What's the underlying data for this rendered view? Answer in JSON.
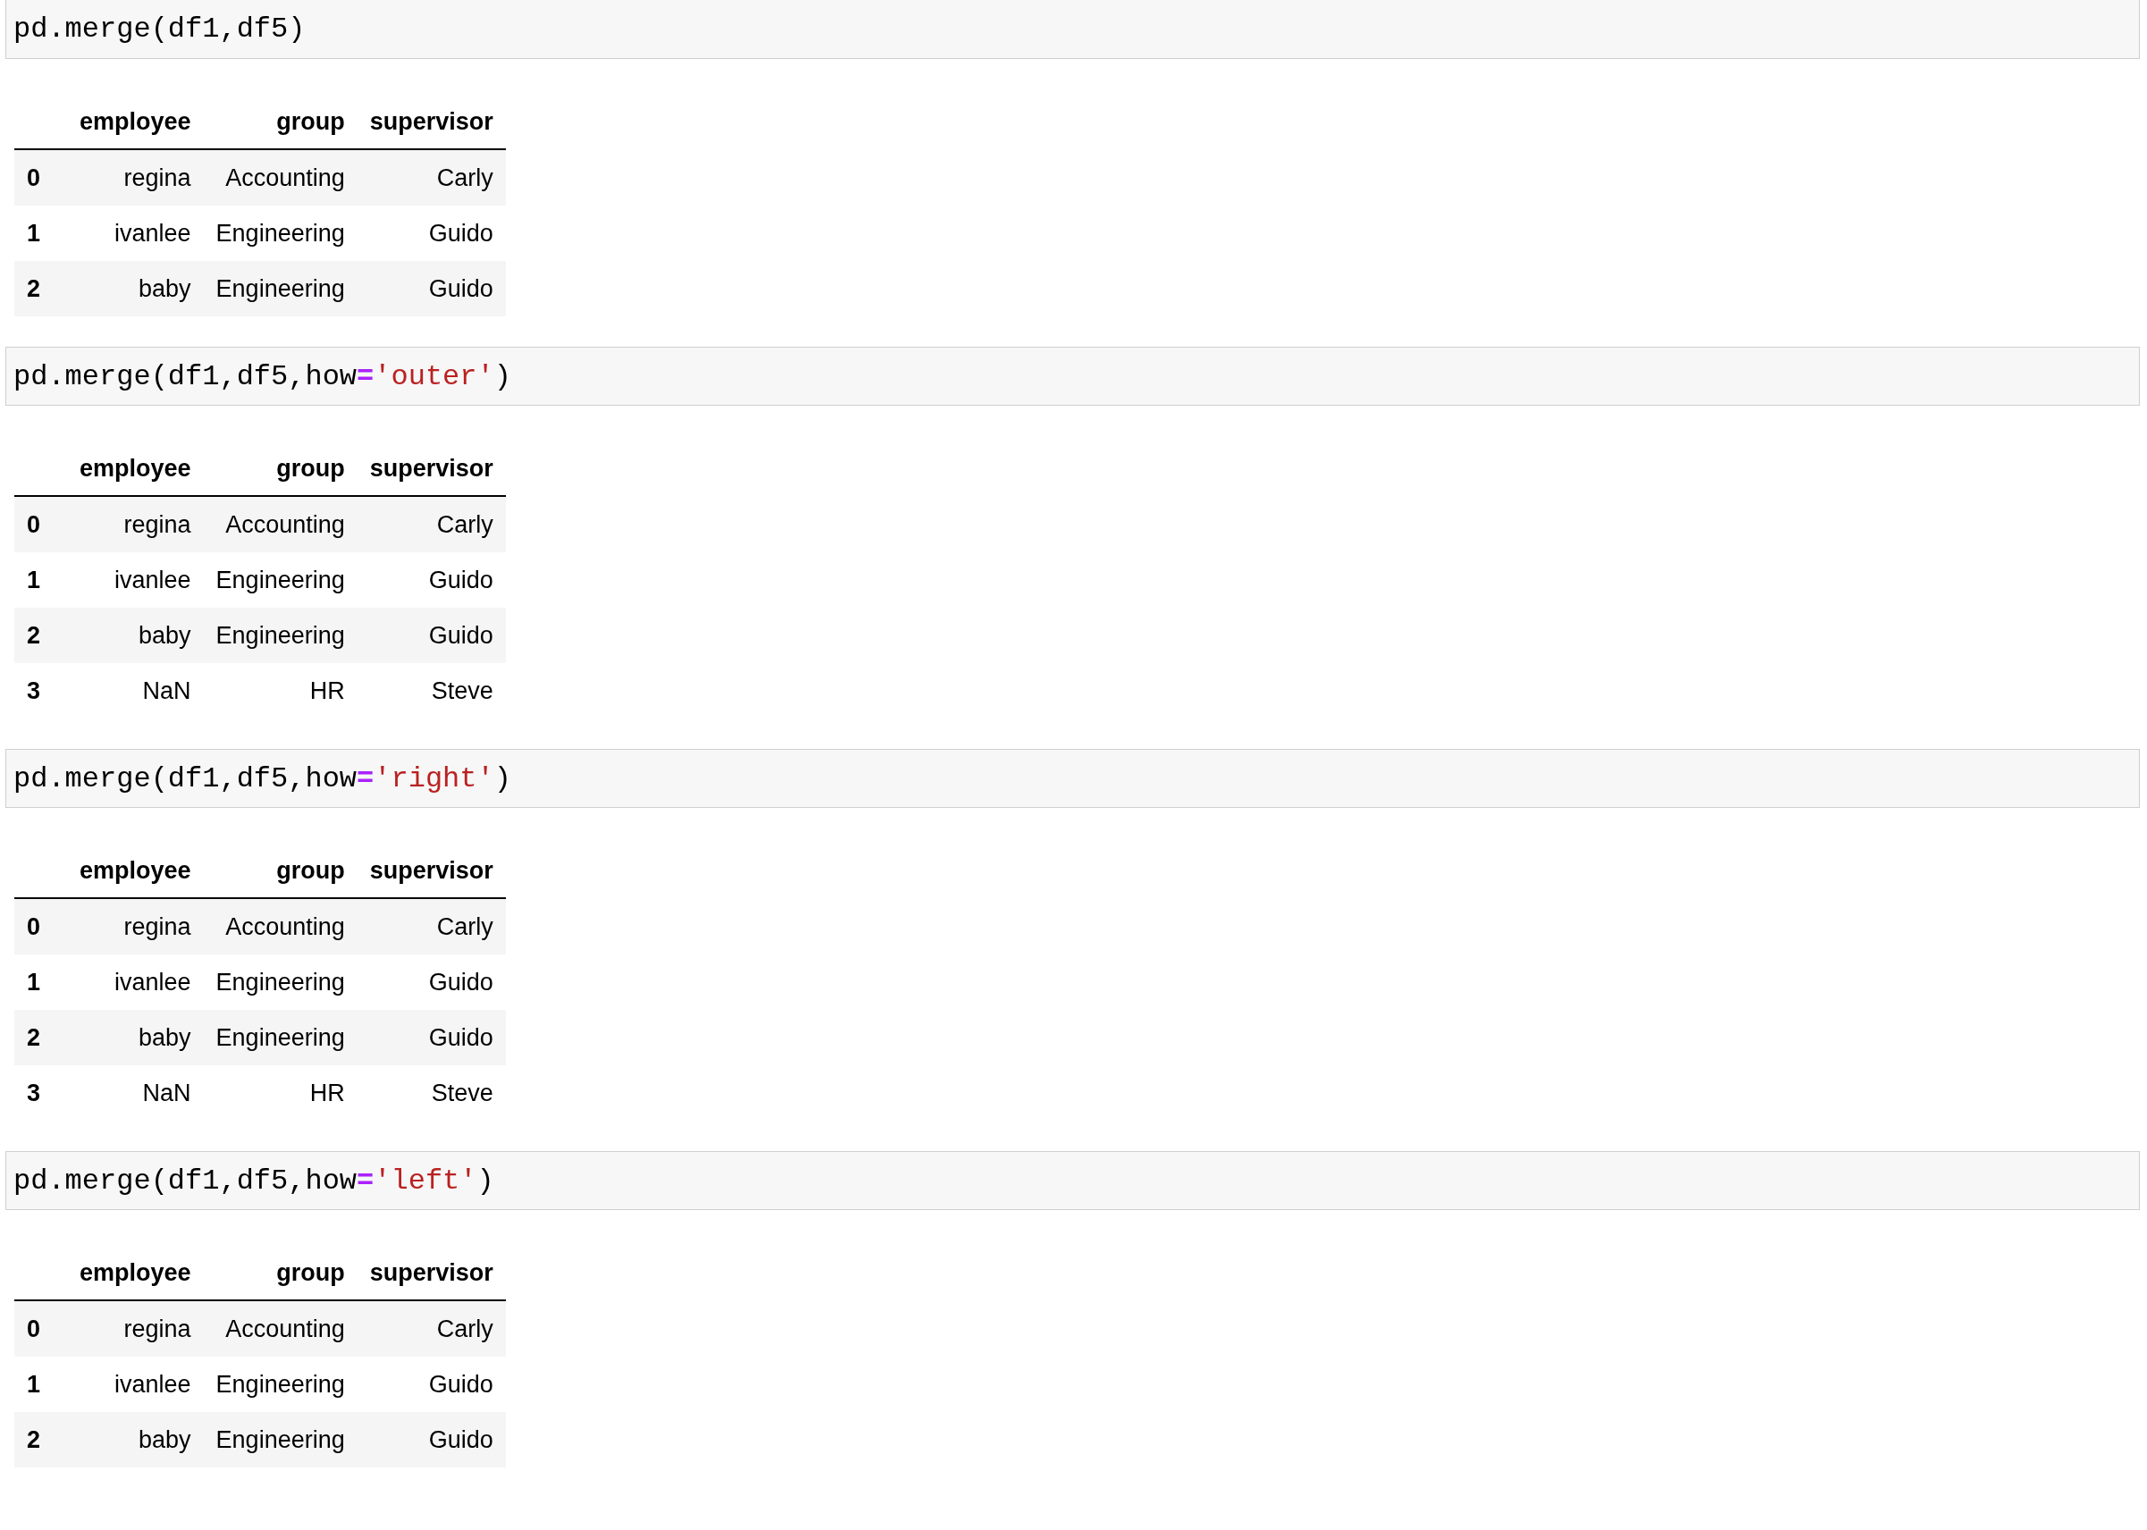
{
  "cells": [
    {
      "code": [
        {
          "kind": "plain",
          "text": "pd.merge(df1,df5)"
        }
      ],
      "table": {
        "columns": [
          "employee",
          "group",
          "supervisor"
        ],
        "rows": [
          {
            "index": "0",
            "values": [
              "regina",
              "Accounting",
              "Carly"
            ]
          },
          {
            "index": "1",
            "values": [
              "ivanlee",
              "Engineering",
              "Guido"
            ]
          },
          {
            "index": "2",
            "values": [
              "baby",
              "Engineering",
              "Guido"
            ]
          }
        ]
      }
    },
    {
      "code": [
        {
          "kind": "plain",
          "text": "pd.merge(df1,df5,how"
        },
        {
          "kind": "operator",
          "text": "="
        },
        {
          "kind": "string",
          "text": "'outer'"
        },
        {
          "kind": "plain",
          "text": ")"
        }
      ],
      "table": {
        "columns": [
          "employee",
          "group",
          "supervisor"
        ],
        "rows": [
          {
            "index": "0",
            "values": [
              "regina",
              "Accounting",
              "Carly"
            ]
          },
          {
            "index": "1",
            "values": [
              "ivanlee",
              "Engineering",
              "Guido"
            ]
          },
          {
            "index": "2",
            "values": [
              "baby",
              "Engineering",
              "Guido"
            ]
          },
          {
            "index": "3",
            "values": [
              "NaN",
              "HR",
              "Steve"
            ]
          }
        ]
      }
    },
    {
      "code": [
        {
          "kind": "plain",
          "text": "pd.merge(df1,df5,how"
        },
        {
          "kind": "operator",
          "text": "="
        },
        {
          "kind": "string",
          "text": "'right'"
        },
        {
          "kind": "plain",
          "text": ")"
        }
      ],
      "table": {
        "columns": [
          "employee",
          "group",
          "supervisor"
        ],
        "rows": [
          {
            "index": "0",
            "values": [
              "regina",
              "Accounting",
              "Carly"
            ]
          },
          {
            "index": "1",
            "values": [
              "ivanlee",
              "Engineering",
              "Guido"
            ]
          },
          {
            "index": "2",
            "values": [
              "baby",
              "Engineering",
              "Guido"
            ]
          },
          {
            "index": "3",
            "values": [
              "NaN",
              "HR",
              "Steve"
            ]
          }
        ]
      }
    },
    {
      "code": [
        {
          "kind": "plain",
          "text": "pd.merge(df1,df5,how"
        },
        {
          "kind": "operator",
          "text": "="
        },
        {
          "kind": "string",
          "text": "'left'"
        },
        {
          "kind": "plain",
          "text": ")"
        }
      ],
      "table": {
        "columns": [
          "employee",
          "group",
          "supervisor"
        ],
        "rows": [
          {
            "index": "0",
            "values": [
              "regina",
              "Accounting",
              "Carly"
            ]
          },
          {
            "index": "1",
            "values": [
              "ivanlee",
              "Engineering",
              "Guido"
            ]
          },
          {
            "index": "2",
            "values": [
              "baby",
              "Engineering",
              "Guido"
            ]
          }
        ]
      }
    }
  ]
}
